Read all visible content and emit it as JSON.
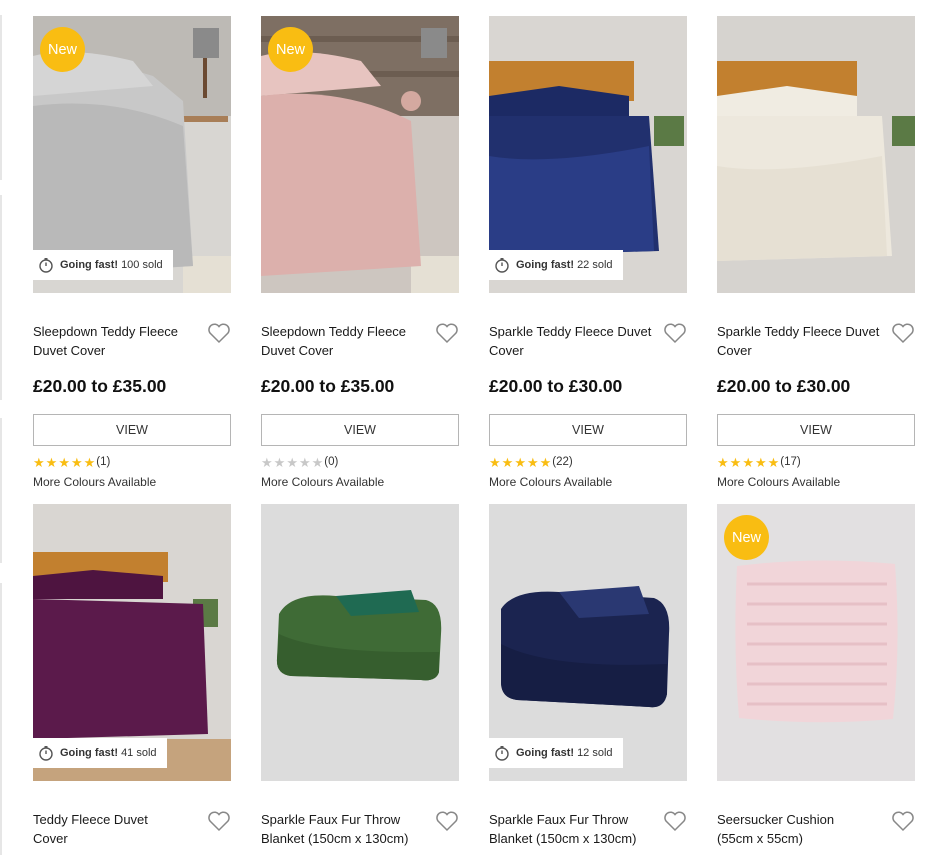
{
  "accent": "#f9bd12",
  "products": [
    {
      "title": "Sleepdown Teddy Fleece Duvet Cover",
      "price": "£20.00 to £35.00",
      "view_label": "VIEW",
      "badge": "New",
      "going_fast": {
        "label": "Going fast!",
        "sold": "100 sold"
      },
      "rating_stars": 5,
      "rating_count": "(1)",
      "more_colours": "More Colours Available",
      "image": "grey-teddy-fleece-bed"
    },
    {
      "title": "Sleepdown Teddy Fleece Duvet Cover",
      "price": "£20.00 to £35.00",
      "view_label": "VIEW",
      "badge": "New",
      "going_fast": null,
      "rating_stars": 0,
      "rating_count": "(0)",
      "more_colours": "More Colours Available",
      "image": "pink-teddy-fleece-bed"
    },
    {
      "title": "Sparkle Teddy Fleece Duvet Cover",
      "price": "£20.00 to £30.00",
      "view_label": "VIEW",
      "badge": null,
      "going_fast": {
        "label": "Going fast!",
        "sold": "22 sold"
      },
      "rating_stars": 5,
      "rating_count": "(22)",
      "more_colours": "More Colours Available",
      "image": "navy-sparkle-fleece-bed"
    },
    {
      "title": "Sparkle Teddy Fleece Duvet Cover",
      "price": "£20.00 to £30.00",
      "view_label": "VIEW",
      "badge": null,
      "going_fast": null,
      "rating_stars": 5,
      "rating_count": "(17)",
      "more_colours": "More Colours Available",
      "image": "cream-sparkle-fleece-bed"
    },
    {
      "title": "Teddy Fleece Duvet Cover",
      "badge": null,
      "going_fast": {
        "label": "Going fast!",
        "sold": "41 sold"
      },
      "image": "plum-teddy-fleece-bed"
    },
    {
      "title": "Sparkle Faux Fur Throw Blanket (150cm x 130cm)",
      "badge": null,
      "going_fast": null,
      "image": "green-faux-fur-throw"
    },
    {
      "title": "Sparkle Faux Fur Throw Blanket (150cm x 130cm)",
      "badge": null,
      "going_fast": {
        "label": "Going fast!",
        "sold": "12 sold"
      },
      "image": "navy-faux-fur-throw"
    },
    {
      "title": "Seersucker Cushion (55cm x 55cm)",
      "badge": "New",
      "going_fast": null,
      "image": "pink-seersucker-cushion"
    }
  ]
}
